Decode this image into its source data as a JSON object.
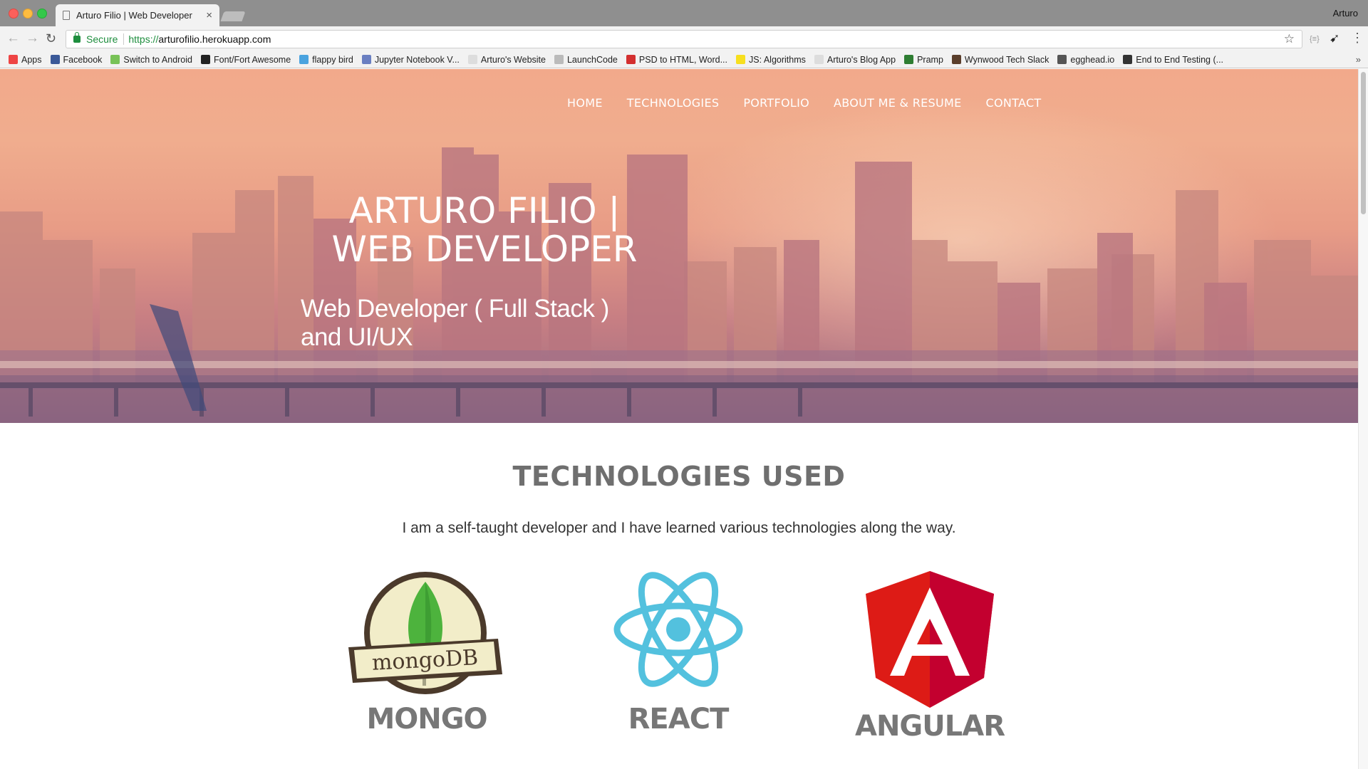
{
  "browser": {
    "tab_title": "Arturo Filio | Web Developer",
    "tab_close": "×",
    "profile_name": "Arturo",
    "secure_label": "Secure",
    "url_scheme": "https://",
    "url_host": "arturofilio.herokuapp.com",
    "icons": [
      "back-icon",
      "forward-icon",
      "reload-icon",
      "lock-icon",
      "star-icon",
      "menu-icon"
    ],
    "bookmarks": [
      {
        "label": "Apps",
        "color": "#e44"
      },
      {
        "label": "Facebook",
        "color": "#3b5998"
      },
      {
        "label": "Switch to Android",
        "color": "#78c257"
      },
      {
        "label": "Font/Fort Awesome",
        "color": "#222"
      },
      {
        "label": "flappy bird",
        "color": "#4aa3df"
      },
      {
        "label": "Jupyter Notebook V...",
        "color": "#6a7fc1"
      },
      {
        "label": "Arturo's Website",
        "color": "#ddd"
      },
      {
        "label": "LaunchCode",
        "color": "#bbb"
      },
      {
        "label": "PSD to HTML, Word...",
        "color": "#d32f2f"
      },
      {
        "label": "JS: Algorithms",
        "color": "#f7df1e"
      },
      {
        "label": "Arturo's Blog App",
        "color": "#ddd"
      },
      {
        "label": "Pramp",
        "color": "#2e7d32"
      },
      {
        "label": "Wynwood Tech Slack",
        "color": "#5a3e2b"
      },
      {
        "label": "egghead.io",
        "color": "#555"
      },
      {
        "label": "End to End Testing (...",
        "color": "#333"
      }
    ],
    "bookmarks_more": "»"
  },
  "hero": {
    "nav": [
      "HOME",
      "TECHNOLOGIES",
      "PORTFOLIO",
      "ABOUT ME & RESUME",
      "CONTACT"
    ],
    "title_line1": "ARTURO FILIO |",
    "title_line2": "WEB DEVELOPER",
    "subtitle_line1": "Web Developer ( Full Stack )",
    "subtitle_line2": "and UI/UX"
  },
  "technologies": {
    "title": "TECHNOLOGIES USED",
    "description": "I am a self-taught developer and I have learned various technologies along the way.",
    "items": [
      {
        "name": "MONGO",
        "logo_text": "mongoDB",
        "icon": "mongodb-logo-icon"
      },
      {
        "name": "REACT",
        "icon": "react-logo-icon"
      },
      {
        "name": "ANGULAR",
        "icon": "angular-logo-icon"
      }
    ]
  },
  "colors": {
    "secure_green": "#1e8e3e",
    "heading_gray": "#6f6f6f",
    "react_blue": "#53c1de",
    "angular_red": "#dd1b16",
    "mongo_green": "#4db33d"
  }
}
